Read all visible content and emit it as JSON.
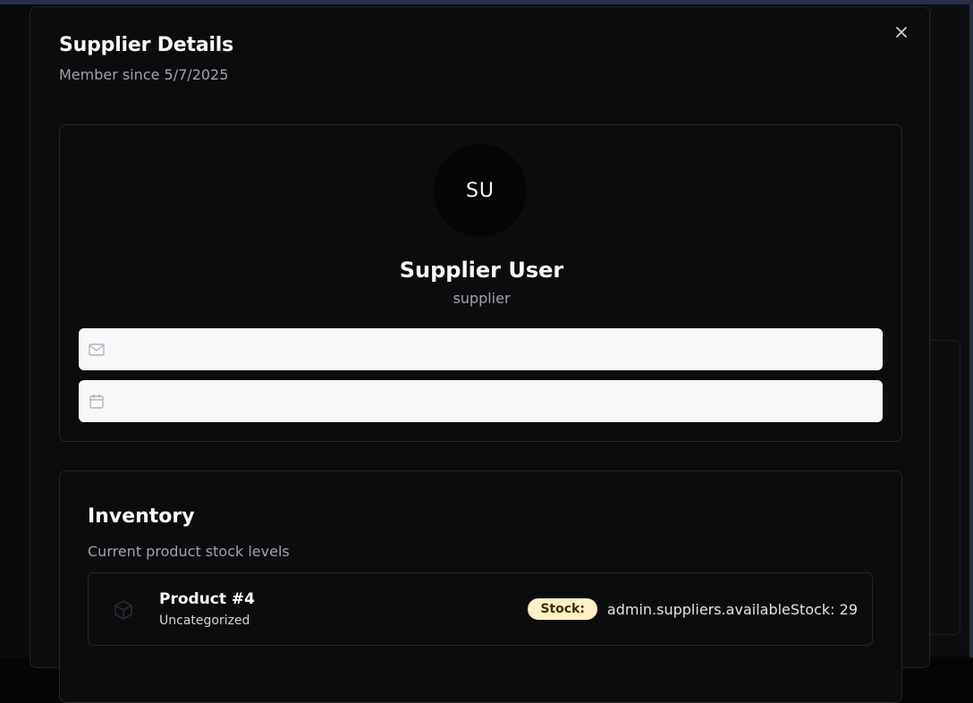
{
  "modal": {
    "title": "Supplier Details",
    "subtitle": "Member since 5/7/2025",
    "close_icon": "close-icon"
  },
  "profile": {
    "avatar_initials": "SU",
    "name": "Supplier User",
    "role": "supplier",
    "email_icon": "mail-icon",
    "email_value": "",
    "date_icon": "calendar-icon",
    "date_value": ""
  },
  "inventory": {
    "title": "Inventory",
    "subtitle": "Current product stock levels",
    "products": [
      {
        "icon": "package-icon",
        "name": "Product #4",
        "category": "Uncategorized",
        "stock_label": "Stock:",
        "stock_value": "admin.suppliers.availableStock: 29"
      }
    ]
  },
  "colors": {
    "modal_bg": "#0c0c0e",
    "field_bg": "#f8f8fa",
    "stock_badge_bg": "#fdf0c8",
    "stock_badge_text": "#3f2d06"
  }
}
